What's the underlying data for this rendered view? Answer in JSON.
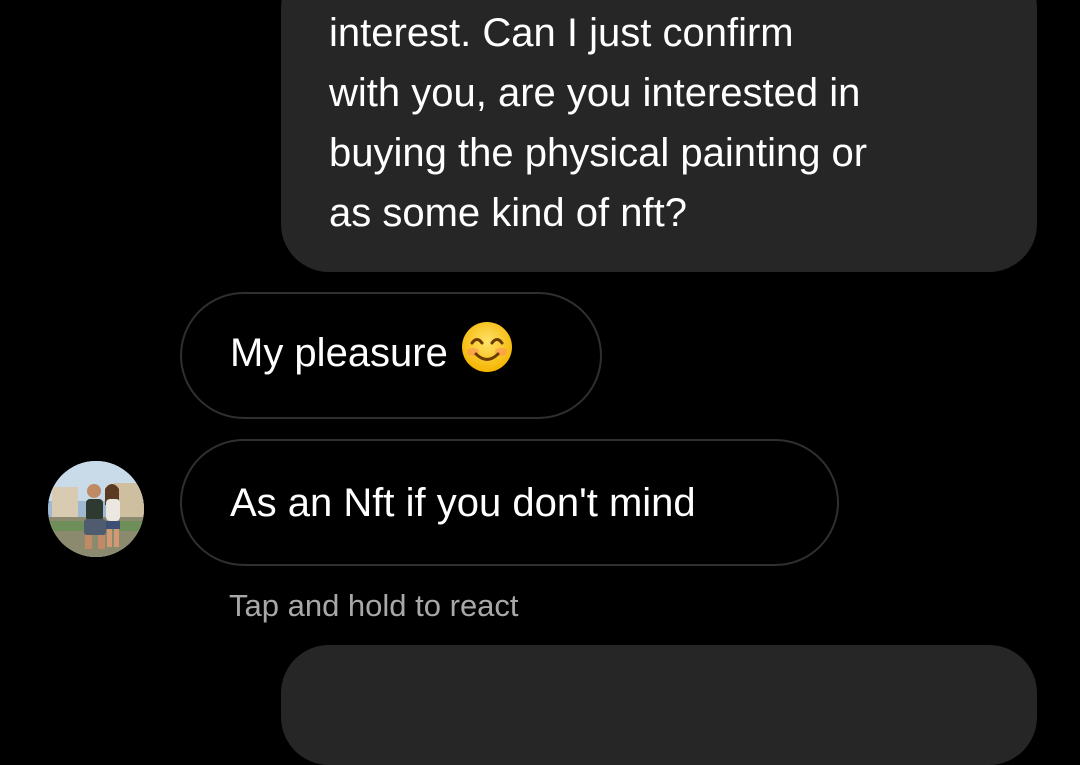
{
  "thread": {
    "sent_message": {
      "text": "interest. Can I just confirm\nwith you, are you interested in\nbuying the physical painting or\nas some kind of nft?"
    },
    "received_messages": [
      {
        "text": "My pleasure",
        "emoji": "smiling-face-with-smiling-eyes"
      },
      {
        "text": "As an Nft if you don't mind"
      }
    ],
    "react_hint": "Tap and hold to react"
  },
  "colors": {
    "background": "#000000",
    "sent_bubble": "#262626",
    "received_border": "#2f2f2f",
    "hint_text": "#a8a8a8"
  }
}
